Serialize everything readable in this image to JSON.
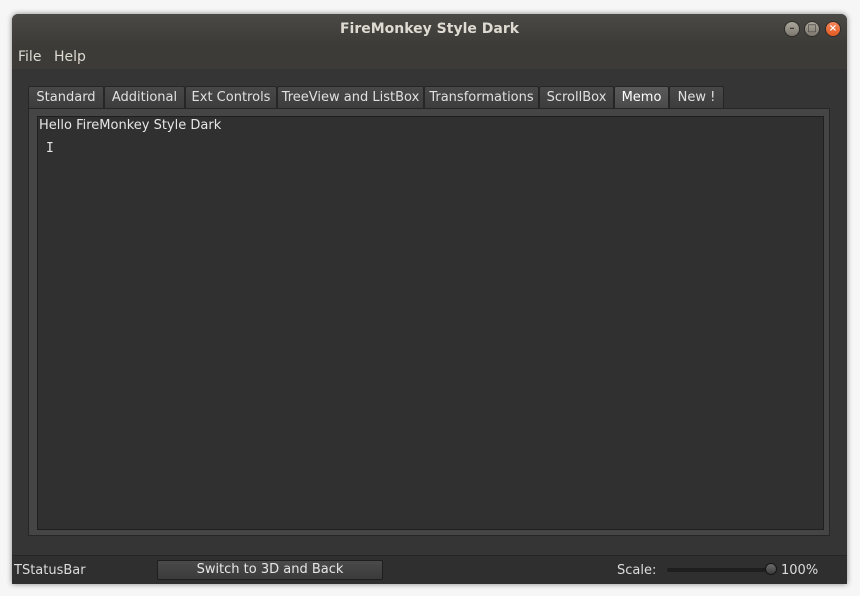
{
  "window": {
    "title": "FireMonkey Style Dark"
  },
  "menu": {
    "items": [
      "File",
      "Help"
    ]
  },
  "tabs": {
    "items": [
      "Standard",
      "Additional",
      "Ext Controls",
      "TreeView and ListBox",
      "Transformations",
      "ScrollBox",
      "Memo",
      "New !"
    ],
    "active": "Memo"
  },
  "memo": {
    "text": "Hello FireMonkey Style Dark",
    "cursor_glyph": "I"
  },
  "statusbar": {
    "label": "TStatusBar",
    "switch_button": "Switch to 3D and Back",
    "scale_label": "Scale:",
    "scale_value": "100%",
    "scale_level": 1.0
  },
  "window_buttons": {
    "minimize": "–",
    "maximize": "□",
    "close": "×"
  },
  "colors": {
    "close_button": "#e25a21",
    "background": "#353535"
  }
}
